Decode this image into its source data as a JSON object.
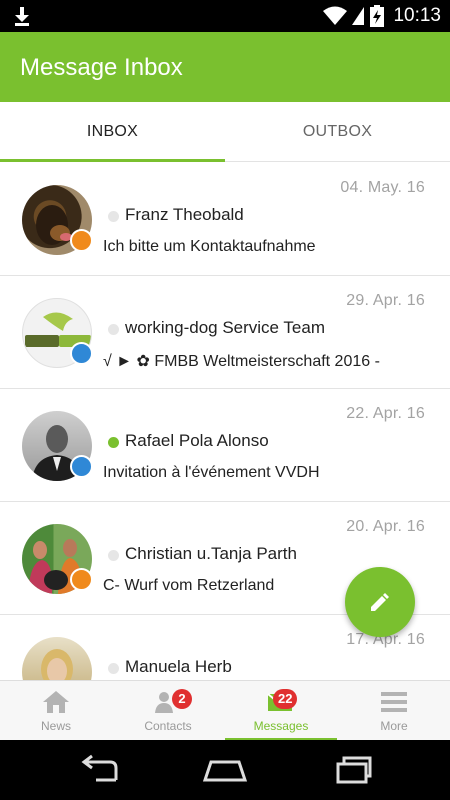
{
  "status_bar": {
    "time": "10:13"
  },
  "app_bar": {
    "title": "Message Inbox"
  },
  "tabs": [
    {
      "label": "INBOX",
      "active": true
    },
    {
      "label": "OUTBOX",
      "active": false
    }
  ],
  "messages": [
    {
      "date": "04. May. 16",
      "sender": "Franz Theobald",
      "preview": "Ich bitte um Kontaktaufnahme",
      "online": false,
      "badge": "orange"
    },
    {
      "date": "29. Apr. 16",
      "sender": "working-dog Service Team",
      "preview": "√ ► ✿ FMBB Weltmeisterschaft 2016 -",
      "online": false,
      "badge": "blue",
      "avatar_text": "working dog"
    },
    {
      "date": "22. Apr. 16",
      "sender": "Rafael Pola Alonso",
      "preview": "Invitation à l'événement VVDH",
      "online": true,
      "badge": "blue"
    },
    {
      "date": "20. Apr. 16",
      "sender": "Christian u.Tanja Parth",
      "preview": "C- Wurf vom Retzerland",
      "online": false,
      "badge": "orange"
    },
    {
      "date": "17. Apr. 16",
      "sender": "Manuela Herb",
      "preview": "",
      "online": false,
      "badge": "orange"
    }
  ],
  "bottom_nav": [
    {
      "label": "News",
      "icon": "house-icon",
      "active": false,
      "count": ""
    },
    {
      "label": "Contacts",
      "icon": "people-icon",
      "active": false,
      "count": "2"
    },
    {
      "label": "Messages",
      "icon": "envelope-icon",
      "active": true,
      "count": "22"
    },
    {
      "label": "More",
      "icon": "menu-icon",
      "active": false,
      "count": ""
    }
  ],
  "colors": {
    "accent": "#7ac02f",
    "badge_orange": "#f08a1c",
    "badge_blue": "#2f88d6",
    "count_red": "#e03030"
  }
}
